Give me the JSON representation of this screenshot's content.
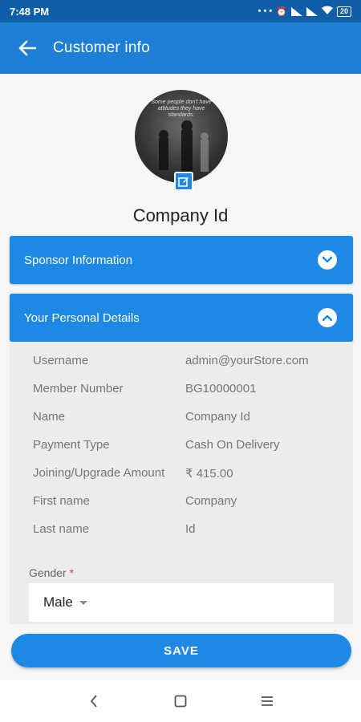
{
  "status_bar": {
    "time": "7:48 PM",
    "battery": "20",
    "icons": [
      "more-icon",
      "alarm-icon",
      "sim1-icon",
      "signal-icon",
      "sim2-icon",
      "signal-icon",
      "wifi-icon",
      "battery-icon"
    ]
  },
  "app_bar": {
    "title": "Customer info",
    "back_icon": "arrow-left-icon"
  },
  "profile": {
    "avatar_quote": "Some people don't have attitudes they have standards.",
    "edit_icon": "edit-icon",
    "name": "Company Id"
  },
  "sponsor_section": {
    "title": "Sponsor Information",
    "toggle_icon": "chevron-down-icon"
  },
  "personal_section": {
    "title": "Your Personal Details",
    "toggle_icon": "chevron-up-icon",
    "rows": [
      {
        "label": "Username",
        "value": "admin@yourStore.com"
      },
      {
        "label": "Member Number",
        "value": "BG10000001"
      },
      {
        "label": "Name",
        "value": "Company Id"
      },
      {
        "label": "Payment Type",
        "value": "Cash On Delivery"
      },
      {
        "label": "Joining/Upgrade Amount",
        "value": "₹ 415.00"
      },
      {
        "label": "First name",
        "value": "Company"
      },
      {
        "label": "Last name",
        "value": "Id"
      }
    ],
    "gender": {
      "label": "Gender",
      "required_mark": "*",
      "selected": "Male"
    }
  },
  "save_button": {
    "label": "SAVE"
  },
  "nav_bar": {
    "back": "nav-back-icon",
    "home": "nav-home-icon",
    "menu": "nav-menu-icon"
  },
  "colors": {
    "status_bar": "#0e5ea8",
    "app_bar": "#1e7fd6",
    "accent": "#1e88e5",
    "panel_bg": "#ececec"
  }
}
